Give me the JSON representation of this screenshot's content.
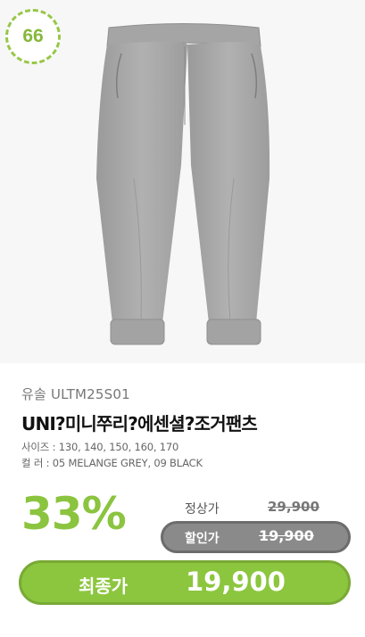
{
  "badge": {
    "text": "66"
  },
  "product": {
    "brand": "유솔 ULTM25S01",
    "title": "UNI?미니쭈리?에센셜?조거팬츠",
    "size_line": "사이즈 : 130, 140, 150, 160, 170",
    "color_line": "컬    러 : 05 MELANGE GREY, 09 BLACK"
  },
  "pricing": {
    "discount_percent": "33%",
    "regular_label": "정상가",
    "regular_price": "29,900",
    "sale_label": "할인가",
    "sale_price": "19,900",
    "final_label": "최종가",
    "final_price": "19,900"
  },
  "colors": {
    "accent_green": "#8cc63f",
    "badge_green": "#97c748",
    "pill_gray": "#8a8a8a"
  }
}
